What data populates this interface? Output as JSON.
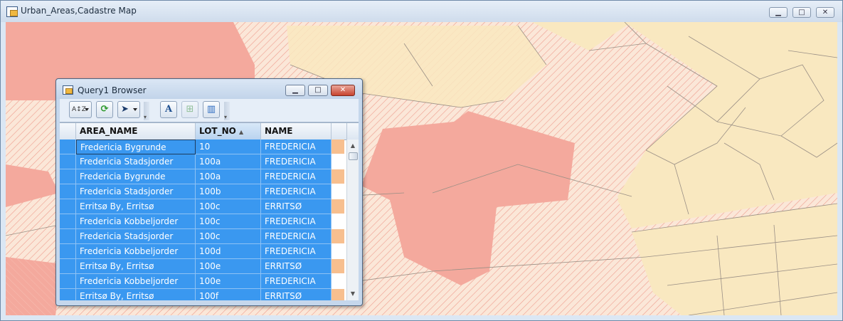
{
  "window": {
    "title": "Urban_Areas,Cadastre Map",
    "minimize": "▁",
    "maximize": "□",
    "close": "✕"
  },
  "query_browser": {
    "title": "Query1 Browser",
    "controls": {
      "minimize": "▁",
      "maximize": "□",
      "close": "✕"
    },
    "toolbar": {
      "sort_icon": "A↕Z",
      "refresh_icon": "⟳",
      "select_icon": "➤",
      "label_icon": "A",
      "add_icon": "⊞",
      "columns_icon": "▥"
    },
    "columns": [
      {
        "label": "AREA_NAME"
      },
      {
        "label": "LOT_NO",
        "sort": "▲"
      },
      {
        "label": "NAME"
      }
    ],
    "rows": [
      {
        "area": "Fredericia Bygrunde",
        "lot": "10",
        "name": "FREDERICIA"
      },
      {
        "area": "Fredericia Stadsjorder",
        "lot": "100a",
        "name": "FREDERICIA"
      },
      {
        "area": "Fredericia Bygrunde",
        "lot": "100a",
        "name": "FREDERICIA"
      },
      {
        "area": "Fredericia Stadsjorder",
        "lot": "100b",
        "name": "FREDERICIA"
      },
      {
        "area": "Erritsø By, Erritsø",
        "lot": "100c",
        "name": "ERRITSØ"
      },
      {
        "area": "Fredericia Kobbeljorder",
        "lot": "100c",
        "name": "FREDERICIA"
      },
      {
        "area": "Fredericia Stadsjorder",
        "lot": "100c",
        "name": "FREDERICIA"
      },
      {
        "area": "Fredericia Kobbeljorder",
        "lot": "100d",
        "name": "FREDERICIA"
      },
      {
        "area": "Erritsø By, Erritsø",
        "lot": "100e",
        "name": "ERRITSØ"
      },
      {
        "area": "Fredericia Kobbeljorder",
        "lot": "100e",
        "name": "FREDERICIA"
      },
      {
        "area": "Erritsø By, Erritsø",
        "lot": "100f",
        "name": "ERRITSØ"
      }
    ]
  },
  "colors": {
    "selection": "#3a98f0",
    "urban_fill": "#f4a99d",
    "parcel_fill": "#f9e8c0",
    "hatch_bg": "#fbe4d2"
  }
}
